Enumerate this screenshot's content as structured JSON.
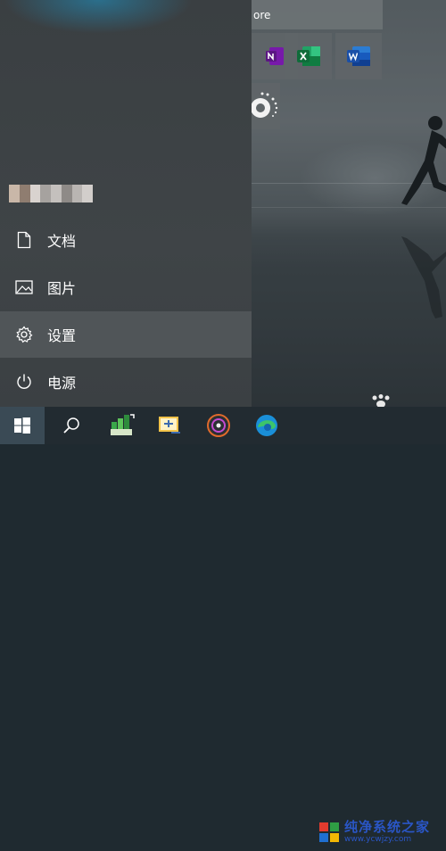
{
  "start_menu": {
    "items": [
      {
        "label": "文档",
        "icon": "document-icon"
      },
      {
        "label": "图片",
        "icon": "pictures-icon"
      },
      {
        "label": "设置",
        "icon": "gear-icon"
      },
      {
        "label": "电源",
        "icon": "power-icon"
      }
    ]
  },
  "tiles": {
    "store_label": "ore",
    "apps": [
      {
        "icon": "onenote-icon"
      },
      {
        "icon": "excel-icon"
      },
      {
        "icon": "word-icon"
      },
      {
        "icon": "groove-music-icon"
      }
    ]
  },
  "taskbar": {
    "apps": [
      {
        "icon": "windows-start-icon"
      },
      {
        "icon": "search-icon"
      },
      {
        "icon": "space-sniffer-icon"
      },
      {
        "icon": "image-tool-icon"
      },
      {
        "icon": "media-player-icon"
      },
      {
        "icon": "edge-icon"
      }
    ],
    "watermark_title": "纯净系统之家",
    "watermark_url": "www.ycwjzy.com"
  },
  "colors": {
    "excel": "#107c41",
    "word": "#185abd",
    "onenote": "#7719aa",
    "accent_blue": "#2a56c6"
  }
}
